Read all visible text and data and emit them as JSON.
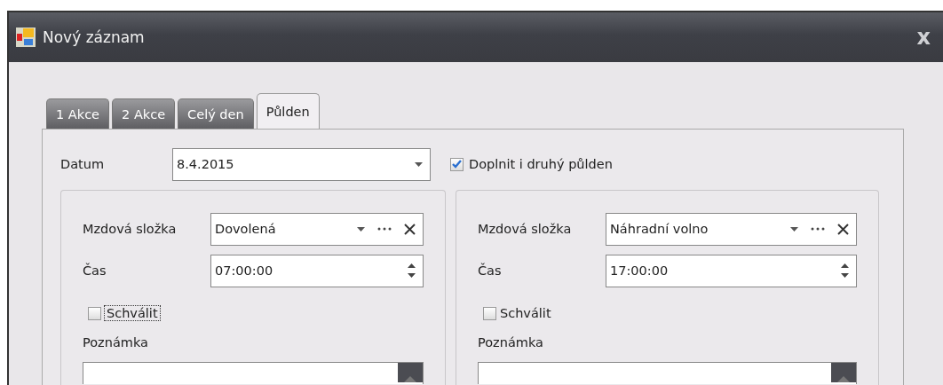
{
  "window": {
    "title": "Nový záznam",
    "close": "x"
  },
  "tabs": [
    {
      "label": "1 Akce",
      "selected": false
    },
    {
      "label": "2 Akce",
      "selected": false
    },
    {
      "label": "Celý den",
      "selected": false
    },
    {
      "label": "Půlden",
      "selected": true
    }
  ],
  "date": {
    "label": "Datum",
    "value": "8.4.2015"
  },
  "fill_second": {
    "label": "Doplnit i druhý půlden",
    "checked": true
  },
  "halves": [
    {
      "wage_label": "Mzdová složka",
      "wage_value": "Dovolená",
      "time_label": "Čas",
      "time_value": "07:00:00",
      "approve": {
        "label": "Schválit",
        "checked": false,
        "focused": true
      },
      "note_label": "Poznámka"
    },
    {
      "wage_label": "Mzdová složka",
      "wage_value": "Náhradní volno",
      "time_label": "Čas",
      "time_value": "17:00:00",
      "approve": {
        "label": "Schválit",
        "checked": false,
        "focused": false
      },
      "note_label": "Poznámka"
    }
  ]
}
